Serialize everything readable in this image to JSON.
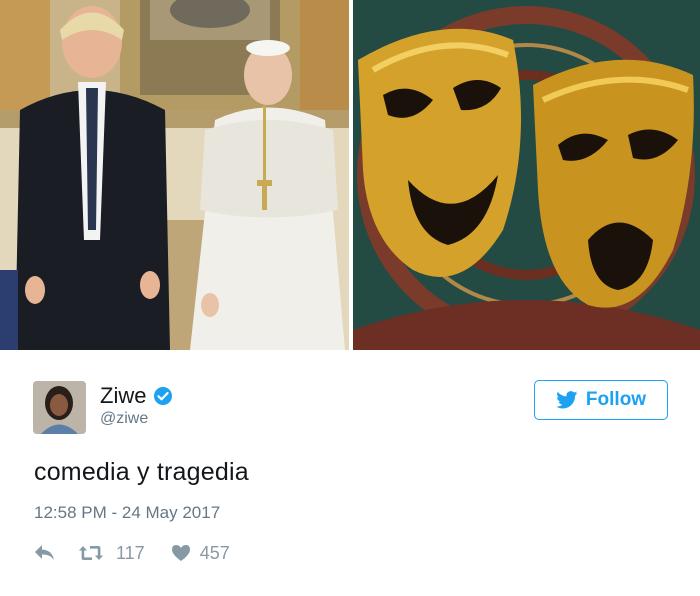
{
  "images": {
    "left": {
      "name": "photo-two-men-standing"
    },
    "right": {
      "name": "photo-theatre-masks"
    }
  },
  "user": {
    "display_name": "Ziwe",
    "handle": "@ziwe",
    "verified": true
  },
  "follow_button": {
    "label": "Follow"
  },
  "tweet": {
    "text": "comedia y tragedia",
    "timestamp": "12:58 PM - 24 May 2017"
  },
  "actions": {
    "retweet_count": "117",
    "like_count": "457"
  },
  "colors": {
    "accent": "#1da1f2",
    "secondary_text": "#657786",
    "action_icons": "#8899a6"
  }
}
